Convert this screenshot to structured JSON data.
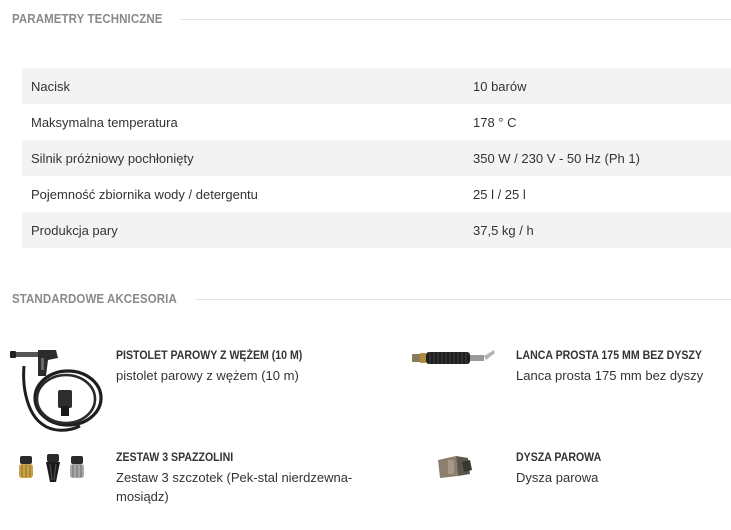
{
  "params": {
    "heading": "PARAMETRY TECHNICZNE",
    "rows": [
      {
        "label": "Nacisk",
        "value": "10 barów"
      },
      {
        "label": "Maksymalna temperatura",
        "value": "178 ° C"
      },
      {
        "label": "Silnik próżniowy pochłonięty",
        "value": "350 W / 230 V - 50 Hz (Ph 1)"
      },
      {
        "label": "Pojemność zbiornika wody / detergentu",
        "value": "25 l / 25 l"
      },
      {
        "label": "Produkcja pary",
        "value": "37,5 kg / h"
      }
    ]
  },
  "accessories": {
    "heading": "STANDARDOWE AKCESORIA",
    "items": [
      {
        "name": "PISTOLET PAROWY Z WĘŻEM (10 M)",
        "desc": "pistolet parowy z wężem (10 m)",
        "icon": "steam-gun-hose-icon"
      },
      {
        "name": "LANCA PROSTA 175 MM BEZ DYSZY",
        "desc": "Lanca prosta 175 mm bez dyszy",
        "icon": "straight-lance-icon"
      },
      {
        "name": "ZESTAW 3 SPAZZOLINI",
        "desc": "Zestaw 3 szczotek (Pek-stal nierdzewna-mosiądz)",
        "icon": "brush-set-icon"
      },
      {
        "name": "DYSZA PAROWA",
        "desc": "Dysza parowa",
        "icon": "steam-nozzle-icon"
      }
    ]
  }
}
